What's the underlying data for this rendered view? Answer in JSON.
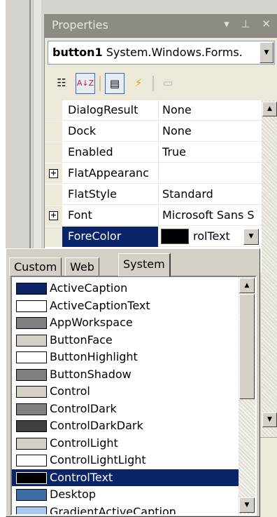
{
  "panel": {
    "title": "Properties",
    "title_controls": "▾ ⊥ ✕",
    "object_name": "button1",
    "object_type": "System.Windows.Forms."
  },
  "toolbar": {
    "icons": [
      "categorized-icon",
      "alphabetical-icon",
      "properties-icon",
      "events-icon",
      "property-pages-icon"
    ],
    "categorized_glyph": "☷",
    "alphabetical_glyph": "A↓Z",
    "properties_glyph": "▤",
    "events_glyph": "⚡",
    "property_pages_glyph": "▭"
  },
  "properties": [
    {
      "name": "DialogResult",
      "value": "None",
      "expandable": false
    },
    {
      "name": "Dock",
      "value": "None",
      "expandable": false
    },
    {
      "name": "Enabled",
      "value": "True",
      "expandable": false
    },
    {
      "name": "FlatAppearanc",
      "value": "",
      "expandable": true
    },
    {
      "name": "FlatStyle",
      "value": "Standard",
      "expandable": false
    },
    {
      "name": "Font",
      "value": "Microsoft Sans S",
      "expandable": true
    },
    {
      "name": "ForeColor",
      "value": "rolText",
      "expandable": false,
      "selected": true,
      "swatch": "#000000"
    }
  ],
  "color_picker": {
    "tabs": [
      "Custom",
      "Web",
      "System"
    ],
    "active_tab": "System",
    "items": [
      {
        "label": "ActiveCaption",
        "color": "#0a246a"
      },
      {
        "label": "ActiveCaptionText",
        "color": "#ffffff"
      },
      {
        "label": "AppWorkspace",
        "color": "#808080"
      },
      {
        "label": "ButtonFace",
        "color": "#d4d0c8"
      },
      {
        "label": "ButtonHighlight",
        "color": "#ffffff"
      },
      {
        "label": "ButtonShadow",
        "color": "#808080"
      },
      {
        "label": "Control",
        "color": "#d4d0c8"
      },
      {
        "label": "ControlDark",
        "color": "#808080"
      },
      {
        "label": "ControlDarkDark",
        "color": "#404040"
      },
      {
        "label": "ControlLight",
        "color": "#d4d0c8"
      },
      {
        "label": "ControlLightLight",
        "color": "#ffffff"
      },
      {
        "label": "ControlText",
        "color": "#000000",
        "selected": true
      },
      {
        "label": "Desktop",
        "color": "#3a6ea5"
      },
      {
        "label": "GradientActiveCaption",
        "color": "#a6caf0"
      }
    ]
  },
  "colors": {
    "selection": "#0a246a",
    "titlebar": "#8d8b83",
    "face": "#d4d0c8"
  }
}
